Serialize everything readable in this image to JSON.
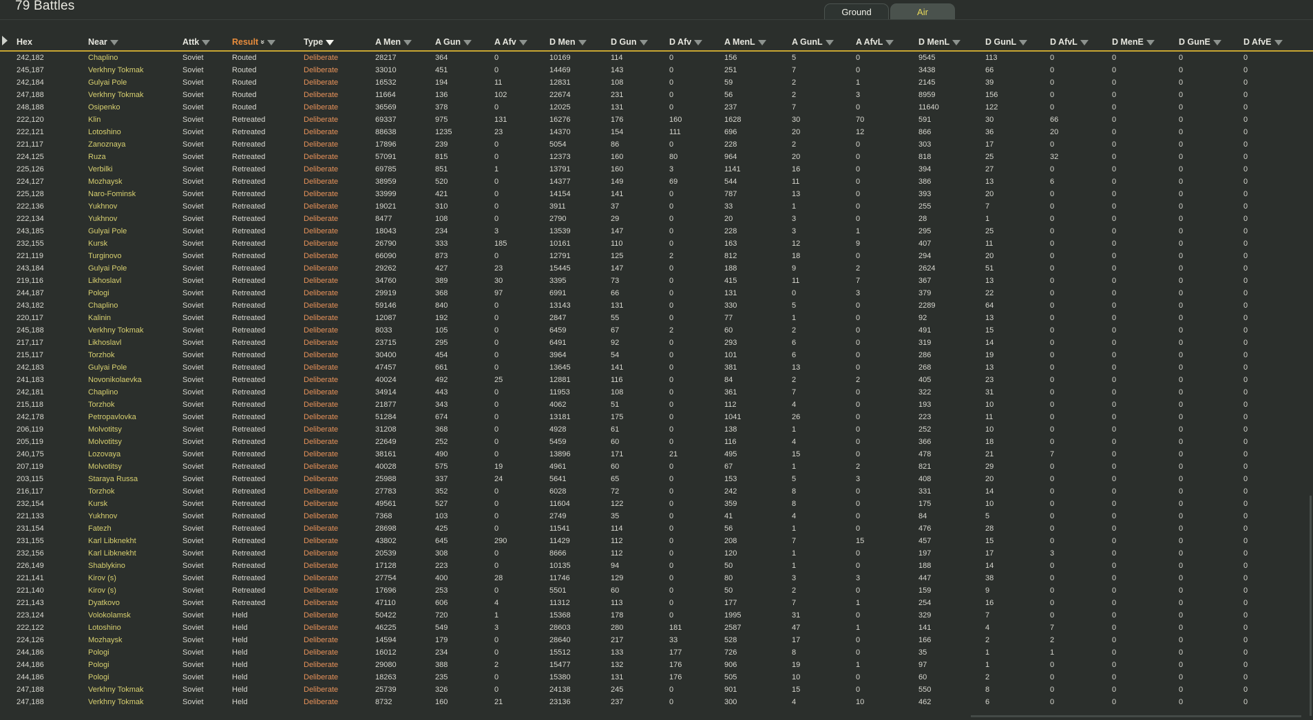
{
  "title": "79 Battles",
  "tabs": [
    {
      "label": "Ground"
    },
    {
      "label": "Air"
    }
  ],
  "columns": [
    {
      "label": "Hex",
      "filter": false,
      "sort": "",
      "active": false
    },
    {
      "label": "Near",
      "filter": true,
      "sort": "",
      "active": false
    },
    {
      "label": "Attk",
      "filter": true,
      "sort": "",
      "active": false
    },
    {
      "label": "Result",
      "filter": true,
      "sort": "desc",
      "active": false
    },
    {
      "label": "Type",
      "filter": true,
      "sort": "",
      "active": true
    },
    {
      "label": "A Men",
      "filter": true,
      "sort": "",
      "active": false
    },
    {
      "label": "A Gun",
      "filter": true,
      "sort": "",
      "active": false
    },
    {
      "label": "A Afv",
      "filter": true,
      "sort": "",
      "active": false
    },
    {
      "label": "D Men",
      "filter": true,
      "sort": "",
      "active": false
    },
    {
      "label": "D Gun",
      "filter": true,
      "sort": "",
      "active": false
    },
    {
      "label": "D Afv",
      "filter": true,
      "sort": "",
      "active": false
    },
    {
      "label": "A MenL",
      "filter": true,
      "sort": "",
      "active": false
    },
    {
      "label": "A GunL",
      "filter": true,
      "sort": "",
      "active": false
    },
    {
      "label": "A AfvL",
      "filter": true,
      "sort": "",
      "active": false
    },
    {
      "label": "D MenL",
      "filter": true,
      "sort": "",
      "active": false
    },
    {
      "label": "D GunL",
      "filter": true,
      "sort": "",
      "active": false
    },
    {
      "label": "D AfvL",
      "filter": true,
      "sort": "",
      "active": false
    },
    {
      "label": "D MenE",
      "filter": true,
      "sort": "",
      "active": false
    },
    {
      "label": "D GunE",
      "filter": true,
      "sort": "",
      "active": false
    },
    {
      "label": "D AfvE",
      "filter": true,
      "sort": "",
      "active": false
    }
  ],
  "rows": [
    [
      "242,182",
      "Chaplino",
      "Soviet",
      "Routed",
      "Deliberate",
      "28217",
      "364",
      "0",
      "10169",
      "114",
      "0",
      "156",
      "5",
      "0",
      "9545",
      "113",
      "0",
      "0",
      "0",
      "0"
    ],
    [
      "245,187",
      "Verkhny Tokmak",
      "Soviet",
      "Routed",
      "Deliberate",
      "33010",
      "451",
      "0",
      "14469",
      "143",
      "0",
      "251",
      "7",
      "0",
      "3438",
      "66",
      "0",
      "0",
      "0",
      "0"
    ],
    [
      "242,184",
      "Gulyai Pole",
      "Soviet",
      "Routed",
      "Deliberate",
      "16532",
      "194",
      "11",
      "12831",
      "108",
      "0",
      "59",
      "2",
      "1",
      "2145",
      "39",
      "0",
      "0",
      "0",
      "0"
    ],
    [
      "247,188",
      "Verkhny Tokmak",
      "Soviet",
      "Routed",
      "Deliberate",
      "11664",
      "136",
      "102",
      "22674",
      "231",
      "0",
      "56",
      "2",
      "3",
      "8959",
      "156",
      "0",
      "0",
      "0",
      "0"
    ],
    [
      "248,188",
      "Osipenko",
      "Soviet",
      "Routed",
      "Deliberate",
      "36569",
      "378",
      "0",
      "12025",
      "131",
      "0",
      "237",
      "7",
      "0",
      "11640",
      "122",
      "0",
      "0",
      "0",
      "0"
    ],
    [
      "222,120",
      "Klin",
      "Soviet",
      "Retreated",
      "Deliberate",
      "69337",
      "975",
      "131",
      "16276",
      "176",
      "160",
      "1628",
      "30",
      "70",
      "591",
      "30",
      "66",
      "0",
      "0",
      "0"
    ],
    [
      "222,121",
      "Lotoshino",
      "Soviet",
      "Retreated",
      "Deliberate",
      "88638",
      "1235",
      "23",
      "14370",
      "154",
      "111",
      "696",
      "20",
      "12",
      "866",
      "36",
      "20",
      "0",
      "0",
      "0"
    ],
    [
      "221,117",
      "Zanoznaya",
      "Soviet",
      "Retreated",
      "Deliberate",
      "17896",
      "239",
      "0",
      "5054",
      "86",
      "0",
      "228",
      "2",
      "0",
      "303",
      "17",
      "0",
      "0",
      "0",
      "0"
    ],
    [
      "224,125",
      "Ruza",
      "Soviet",
      "Retreated",
      "Deliberate",
      "57091",
      "815",
      "0",
      "12373",
      "160",
      "80",
      "964",
      "20",
      "0",
      "818",
      "25",
      "32",
      "0",
      "0",
      "0"
    ],
    [
      "225,126",
      "Verbilki",
      "Soviet",
      "Retreated",
      "Deliberate",
      "69785",
      "851",
      "1",
      "13791",
      "160",
      "3",
      "1141",
      "16",
      "0",
      "394",
      "27",
      "0",
      "0",
      "0",
      "0"
    ],
    [
      "224,127",
      "Mozhaysk",
      "Soviet",
      "Retreated",
      "Deliberate",
      "38959",
      "520",
      "0",
      "14377",
      "149",
      "69",
      "544",
      "11",
      "0",
      "386",
      "13",
      "6",
      "0",
      "0",
      "0"
    ],
    [
      "225,128",
      "Naro-Fominsk",
      "Soviet",
      "Retreated",
      "Deliberate",
      "33999",
      "421",
      "0",
      "14154",
      "141",
      "0",
      "787",
      "13",
      "0",
      "393",
      "20",
      "0",
      "0",
      "0",
      "0"
    ],
    [
      "222,136",
      "Yukhnov",
      "Soviet",
      "Retreated",
      "Deliberate",
      "19021",
      "310",
      "0",
      "3911",
      "37",
      "0",
      "33",
      "1",
      "0",
      "255",
      "7",
      "0",
      "0",
      "0",
      "0"
    ],
    [
      "222,134",
      "Yukhnov",
      "Soviet",
      "Retreated",
      "Deliberate",
      "8477",
      "108",
      "0",
      "2790",
      "29",
      "0",
      "20",
      "3",
      "0",
      "28",
      "1",
      "0",
      "0",
      "0",
      "0"
    ],
    [
      "243,185",
      "Gulyai Pole",
      "Soviet",
      "Retreated",
      "Deliberate",
      "18043",
      "234",
      "3",
      "13539",
      "147",
      "0",
      "228",
      "3",
      "1",
      "295",
      "25",
      "0",
      "0",
      "0",
      "0"
    ],
    [
      "232,155",
      "Kursk",
      "Soviet",
      "Retreated",
      "Deliberate",
      "26790",
      "333",
      "185",
      "10161",
      "110",
      "0",
      "163",
      "12",
      "9",
      "407",
      "11",
      "0",
      "0",
      "0",
      "0"
    ],
    [
      "221,119",
      "Turginovo",
      "Soviet",
      "Retreated",
      "Deliberate",
      "66090",
      "873",
      "0",
      "12791",
      "125",
      "2",
      "812",
      "18",
      "0",
      "294",
      "20",
      "0",
      "0",
      "0",
      "0"
    ],
    [
      "243,184",
      "Gulyai Pole",
      "Soviet",
      "Retreated",
      "Deliberate",
      "29262",
      "427",
      "23",
      "15445",
      "147",
      "0",
      "188",
      "9",
      "2",
      "2624",
      "51",
      "0",
      "0",
      "0",
      "0"
    ],
    [
      "219,116",
      "Likhoslavl",
      "Soviet",
      "Retreated",
      "Deliberate",
      "34760",
      "389",
      "30",
      "3395",
      "73",
      "0",
      "415",
      "11",
      "7",
      "367",
      "13",
      "0",
      "0",
      "0",
      "0"
    ],
    [
      "244,187",
      "Pologi",
      "Soviet",
      "Retreated",
      "Deliberate",
      "29919",
      "368",
      "97",
      "6991",
      "66",
      "0",
      "131",
      "0",
      "3",
      "379",
      "22",
      "0",
      "0",
      "0",
      "0"
    ],
    [
      "243,182",
      "Chaplino",
      "Soviet",
      "Retreated",
      "Deliberate",
      "59146",
      "840",
      "0",
      "13143",
      "131",
      "0",
      "330",
      "5",
      "0",
      "2289",
      "64",
      "0",
      "0",
      "0",
      "0"
    ],
    [
      "220,117",
      "Kalinin",
      "Soviet",
      "Retreated",
      "Deliberate",
      "12087",
      "192",
      "0",
      "2847",
      "55",
      "0",
      "77",
      "1",
      "0",
      "92",
      "13",
      "0",
      "0",
      "0",
      "0"
    ],
    [
      "245,188",
      "Verkhny Tokmak",
      "Soviet",
      "Retreated",
      "Deliberate",
      "8033",
      "105",
      "0",
      "6459",
      "67",
      "2",
      "60",
      "2",
      "0",
      "491",
      "15",
      "0",
      "0",
      "0",
      "0"
    ],
    [
      "217,117",
      "Likhoslavl",
      "Soviet",
      "Retreated",
      "Deliberate",
      "23715",
      "295",
      "0",
      "6491",
      "92",
      "0",
      "293",
      "6",
      "0",
      "319",
      "14",
      "0",
      "0",
      "0",
      "0"
    ],
    [
      "215,117",
      "Torzhok",
      "Soviet",
      "Retreated",
      "Deliberate",
      "30400",
      "454",
      "0",
      "3964",
      "54",
      "0",
      "101",
      "6",
      "0",
      "286",
      "19",
      "0",
      "0",
      "0",
      "0"
    ],
    [
      "242,183",
      "Gulyai Pole",
      "Soviet",
      "Retreated",
      "Deliberate",
      "47457",
      "661",
      "0",
      "13645",
      "141",
      "0",
      "381",
      "13",
      "0",
      "268",
      "13",
      "0",
      "0",
      "0",
      "0"
    ],
    [
      "241,183",
      "Novonikolaevka",
      "Soviet",
      "Retreated",
      "Deliberate",
      "40024",
      "492",
      "25",
      "12881",
      "116",
      "0",
      "84",
      "2",
      "2",
      "405",
      "23",
      "0",
      "0",
      "0",
      "0"
    ],
    [
      "242,181",
      "Chaplino",
      "Soviet",
      "Retreated",
      "Deliberate",
      "34914",
      "443",
      "0",
      "11953",
      "108",
      "0",
      "361",
      "7",
      "0",
      "322",
      "31",
      "0",
      "0",
      "0",
      "0"
    ],
    [
      "215,118",
      "Torzhok",
      "Soviet",
      "Retreated",
      "Deliberate",
      "21877",
      "343",
      "0",
      "4062",
      "51",
      "0",
      "112",
      "4",
      "0",
      "193",
      "10",
      "0",
      "0",
      "0",
      "0"
    ],
    [
      "242,178",
      "Petropavlovka",
      "Soviet",
      "Retreated",
      "Deliberate",
      "51284",
      "674",
      "0",
      "13181",
      "175",
      "0",
      "1041",
      "26",
      "0",
      "223",
      "11",
      "0",
      "0",
      "0",
      "0"
    ],
    [
      "206,119",
      "Molvotitsy",
      "Soviet",
      "Retreated",
      "Deliberate",
      "31208",
      "368",
      "0",
      "4928",
      "61",
      "0",
      "138",
      "1",
      "0",
      "252",
      "10",
      "0",
      "0",
      "0",
      "0"
    ],
    [
      "205,119",
      "Molvotitsy",
      "Soviet",
      "Retreated",
      "Deliberate",
      "22649",
      "252",
      "0",
      "5459",
      "60",
      "0",
      "116",
      "4",
      "0",
      "366",
      "18",
      "0",
      "0",
      "0",
      "0"
    ],
    [
      "240,175",
      "Lozovaya",
      "Soviet",
      "Retreated",
      "Deliberate",
      "38161",
      "490",
      "0",
      "13896",
      "171",
      "21",
      "495",
      "15",
      "0",
      "478",
      "21",
      "7",
      "0",
      "0",
      "0"
    ],
    [
      "207,119",
      "Molvotitsy",
      "Soviet",
      "Retreated",
      "Deliberate",
      "40028",
      "575",
      "19",
      "4961",
      "60",
      "0",
      "67",
      "1",
      "2",
      "821",
      "29",
      "0",
      "0",
      "0",
      "0"
    ],
    [
      "203,115",
      "Staraya Russa",
      "Soviet",
      "Retreated",
      "Deliberate",
      "25988",
      "337",
      "24",
      "5641",
      "65",
      "0",
      "153",
      "5",
      "3",
      "408",
      "20",
      "0",
      "0",
      "0",
      "0"
    ],
    [
      "216,117",
      "Torzhok",
      "Soviet",
      "Retreated",
      "Deliberate",
      "27783",
      "352",
      "0",
      "6028",
      "72",
      "0",
      "242",
      "8",
      "0",
      "331",
      "14",
      "0",
      "0",
      "0",
      "0"
    ],
    [
      "232,154",
      "Kursk",
      "Soviet",
      "Retreated",
      "Deliberate",
      "49561",
      "527",
      "0",
      "11604",
      "122",
      "0",
      "359",
      "8",
      "0",
      "175",
      "10",
      "0",
      "0",
      "0",
      "0"
    ],
    [
      "221,133",
      "Yukhnov",
      "Soviet",
      "Retreated",
      "Deliberate",
      "7368",
      "103",
      "0",
      "2749",
      "35",
      "0",
      "41",
      "4",
      "0",
      "84",
      "5",
      "0",
      "0",
      "0",
      "0"
    ],
    [
      "231,154",
      "Fatezh",
      "Soviet",
      "Retreated",
      "Deliberate",
      "28698",
      "425",
      "0",
      "11541",
      "114",
      "0",
      "56",
      "1",
      "0",
      "476",
      "28",
      "0",
      "0",
      "0",
      "0"
    ],
    [
      "231,155",
      "Karl Libknekht",
      "Soviet",
      "Retreated",
      "Deliberate",
      "43802",
      "645",
      "290",
      "11429",
      "112",
      "0",
      "208",
      "7",
      "15",
      "457",
      "15",
      "0",
      "0",
      "0",
      "0"
    ],
    [
      "232,156",
      "Karl Libknekht",
      "Soviet",
      "Retreated",
      "Deliberate",
      "20539",
      "308",
      "0",
      "8666",
      "112",
      "0",
      "120",
      "1",
      "0",
      "197",
      "17",
      "3",
      "0",
      "0",
      "0"
    ],
    [
      "226,149",
      "Shablykino",
      "Soviet",
      "Retreated",
      "Deliberate",
      "17128",
      "223",
      "0",
      "10135",
      "94",
      "0",
      "50",
      "1",
      "0",
      "188",
      "14",
      "0",
      "0",
      "0",
      "0"
    ],
    [
      "221,141",
      "Kirov (s)",
      "Soviet",
      "Retreated",
      "Deliberate",
      "27754",
      "400",
      "28",
      "11746",
      "129",
      "0",
      "80",
      "3",
      "3",
      "447",
      "38",
      "0",
      "0",
      "0",
      "0"
    ],
    [
      "221,140",
      "Kirov (s)",
      "Soviet",
      "Retreated",
      "Deliberate",
      "17696",
      "253",
      "0",
      "5501",
      "60",
      "0",
      "50",
      "2",
      "0",
      "159",
      "9",
      "0",
      "0",
      "0",
      "0"
    ],
    [
      "221,143",
      "Dyatkovo",
      "Soviet",
      "Retreated",
      "Deliberate",
      "47110",
      "606",
      "4",
      "11312",
      "113",
      "0",
      "177",
      "7",
      "1",
      "254",
      "16",
      "0",
      "0",
      "0",
      "0"
    ],
    [
      "223,124",
      "Volokolamsk",
      "Soviet",
      "Held",
      "Deliberate",
      "50422",
      "720",
      "1",
      "15368",
      "178",
      "0",
      "1995",
      "31",
      "0",
      "329",
      "7",
      "0",
      "0",
      "0",
      "0"
    ],
    [
      "222,122",
      "Lotoshino",
      "Soviet",
      "Held",
      "Deliberate",
      "46225",
      "549",
      "3",
      "28603",
      "280",
      "181",
      "2587",
      "47",
      "1",
      "141",
      "4",
      "7",
      "0",
      "0",
      "0"
    ],
    [
      "224,126",
      "Mozhaysk",
      "Soviet",
      "Held",
      "Deliberate",
      "14594",
      "179",
      "0",
      "28640",
      "217",
      "33",
      "528",
      "17",
      "0",
      "166",
      "2",
      "2",
      "0",
      "0",
      "0"
    ],
    [
      "244,186",
      "Pologi",
      "Soviet",
      "Held",
      "Deliberate",
      "16012",
      "234",
      "0",
      "15512",
      "133",
      "177",
      "726",
      "8",
      "0",
      "35",
      "1",
      "1",
      "0",
      "0",
      "0"
    ],
    [
      "244,186",
      "Pologi",
      "Soviet",
      "Held",
      "Deliberate",
      "29080",
      "388",
      "2",
      "15477",
      "132",
      "176",
      "906",
      "19",
      "1",
      "97",
      "1",
      "0",
      "0",
      "0",
      "0"
    ],
    [
      "244,186",
      "Pologi",
      "Soviet",
      "Held",
      "Deliberate",
      "18263",
      "235",
      "0",
      "15380",
      "131",
      "176",
      "505",
      "10",
      "0",
      "60",
      "2",
      "0",
      "0",
      "0",
      "0"
    ],
    [
      "247,188",
      "Verkhny Tokmak",
      "Soviet",
      "Held",
      "Deliberate",
      "25739",
      "326",
      "0",
      "24138",
      "245",
      "0",
      "901",
      "15",
      "0",
      "550",
      "8",
      "0",
      "0",
      "0",
      "0"
    ],
    [
      "247,188",
      "Verkhny Tokmak",
      "Soviet",
      "Held",
      "Deliberate",
      "8732",
      "160",
      "21",
      "23136",
      "237",
      "0",
      "300",
      "4",
      "10",
      "462",
      "6",
      "0",
      "0",
      "0",
      "0"
    ]
  ]
}
